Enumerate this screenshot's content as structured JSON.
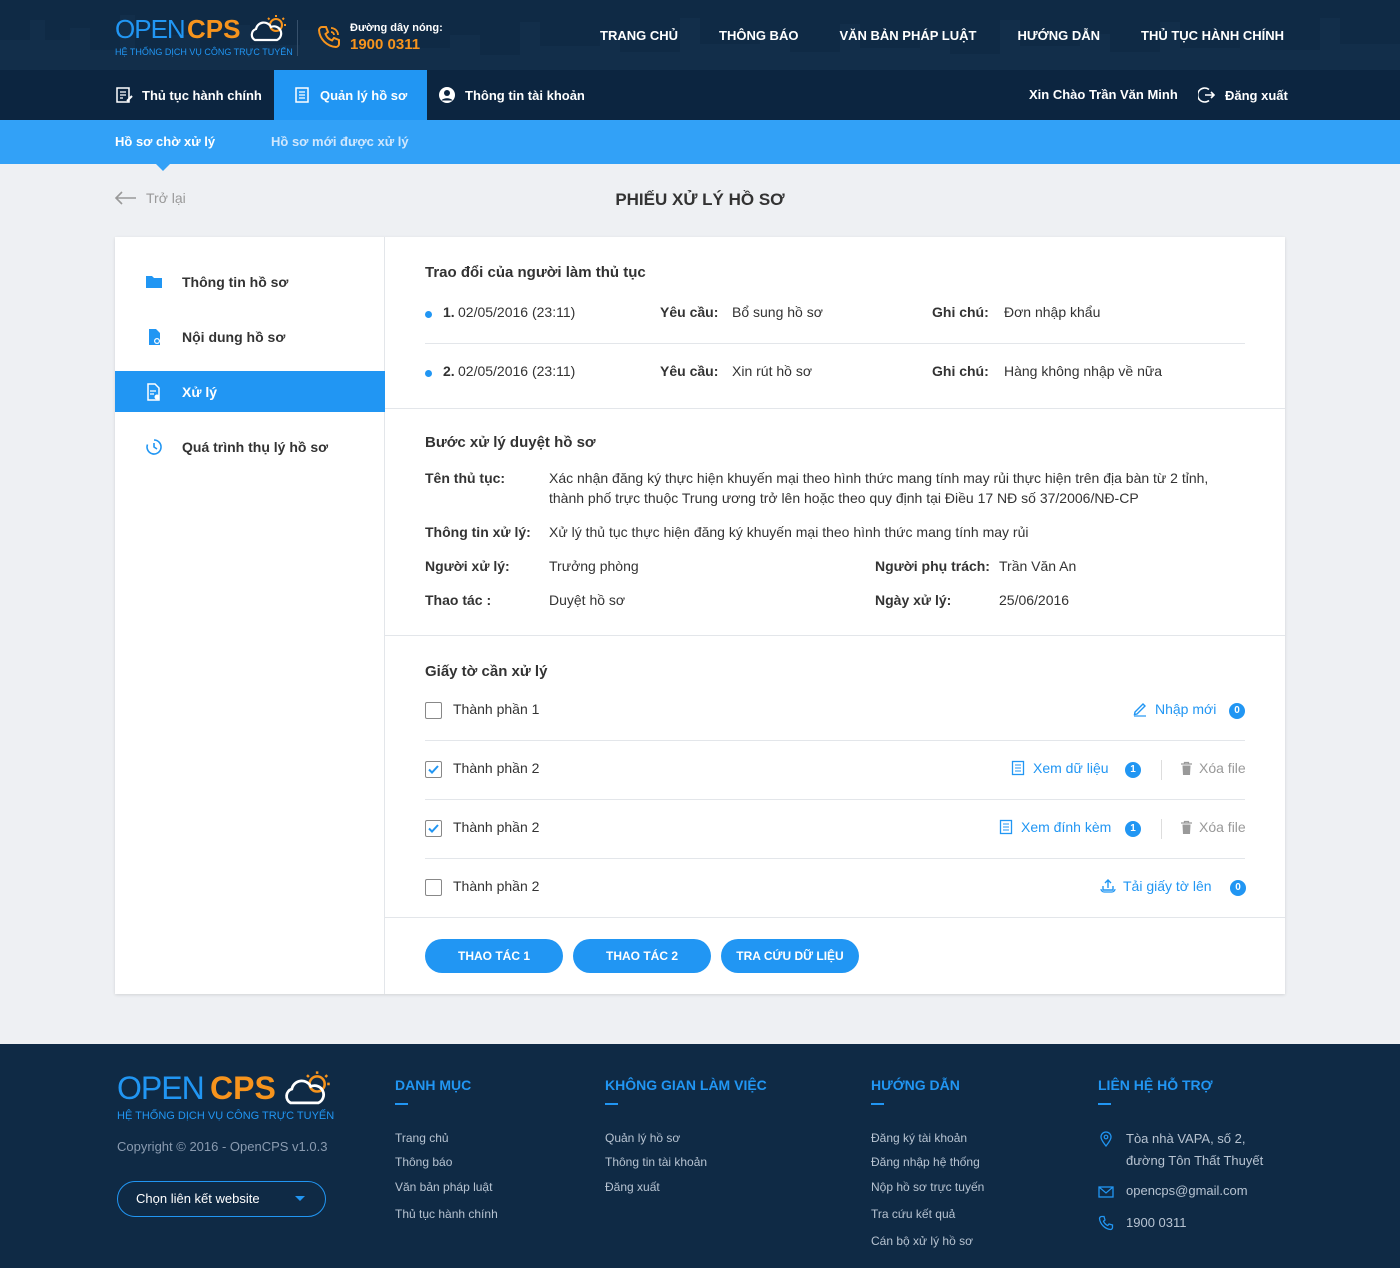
{
  "brand": {
    "open": "OPEN",
    "cps": "CPS",
    "tagline": "HỆ THỐNG DỊCH VỤ CÔNG TRỰC TUYẾN"
  },
  "hotline": {
    "label": "Đường dây nóng:",
    "number": "1900 0311"
  },
  "main_nav": [
    "TRANG CHỦ",
    "THÔNG BÁO",
    "VĂN BẢN PHÁP LUẬT",
    "HƯỚNG DẪN",
    "THỦ TỤC HÀNH CHÍNH"
  ],
  "sub_nav": {
    "items": [
      "Thủ tục hành chính",
      "Quản lý hồ sơ",
      "Thông tin tài khoản"
    ],
    "active_index": 1,
    "greeting": "Xin Chào Trần Văn Minh",
    "logout": "Đăng xuất"
  },
  "tabs": {
    "items": [
      "Hồ sơ chờ xử lý",
      "Hồ sơ mới được xử lý"
    ],
    "active_index": 0
  },
  "back_label": "Trở lại",
  "page_title": "PHIẾU XỬ LÝ HỒ SƠ",
  "sidebar": {
    "items": [
      "Thông tin hồ sơ",
      "Nội dung hồ sơ",
      "Xử lý",
      "Quá trình thụ lý hồ sơ"
    ],
    "active_index": 2
  },
  "exchange": {
    "title": "Trao đổi của người làm thủ tục",
    "request_label": "Yêu cầu:",
    "note_label": "Ghi chú:",
    "entries": [
      {
        "index": "1.",
        "datetime": "02/05/2016 (23:11)",
        "request": "Bổ sung hồ sơ",
        "note": "Đơn nhập khẩu"
      },
      {
        "index": "2.",
        "datetime": "02/05/2016 (23:11)",
        "request": "Xin rút hồ sơ",
        "note": "Hàng không nhập về nữa"
      }
    ]
  },
  "step": {
    "title": "Bước xử lý duyệt hồ sơ",
    "procedure_label": "Tên thủ tục:",
    "procedure_line1": "Xác nhận đăng ký thực hiện khuyến mại theo hình thức mang tính may rủi thực hiện trên địa bàn từ 2 tỉnh,",
    "procedure_line2": "thành phố trực thuộc Trung ương trở lên hoặc theo quy định tại Điều 17 NĐ số 37/2006/NĐ-CP",
    "info_label": "Thông tin xử lý:",
    "info_value": "Xử lý thủ tục thực hiện đăng ký khuyến mại theo hình thức mang tính may rủi",
    "handler_label": "Người xử lý:",
    "handler_value": "Trưởng phòng",
    "owner_label": "Người phụ trách:",
    "owner_value": "Trần Văn An",
    "action_label": "Thao tác :",
    "action_value": "Duyệt hồ sơ",
    "date_label": "Ngày xử lý:",
    "date_value": "25/06/2016"
  },
  "documents": {
    "title": "Giấy tờ cần xử lý",
    "delete_label": "Xóa file",
    "rows": [
      {
        "name": "Thành phần 1",
        "checked": false,
        "action": "Nhập mới",
        "count": "0"
      },
      {
        "name": "Thành phần 2",
        "checked": true,
        "action": "Xem dữ liệu",
        "count": "1"
      },
      {
        "name": "Thành phần 2",
        "checked": true,
        "action": "Xem đính kèm",
        "count": "1"
      },
      {
        "name": "Thành phần 2",
        "checked": false,
        "action": "Tải giấy tờ lên",
        "count": "0"
      }
    ]
  },
  "buttons": [
    "THAO TÁC 1",
    "THAO TÁC 2",
    "TRA CỨU DỮ LIỆU"
  ],
  "footer": {
    "copyright": "Copyright © 2016 - OpenCPS v1.0.3",
    "select_placeholder": "Chọn liên kết website",
    "columns": [
      {
        "heading": "DANH MỤC",
        "links": [
          "Trang chủ",
          "Thông báo",
          "Văn bản pháp luật",
          "Thủ tục hành chính"
        ]
      },
      {
        "heading": "KHÔNG GIAN LÀM VIỆC",
        "links": [
          "Quản lý hồ sơ",
          "Thông tin tài khoản",
          "Đăng xuất"
        ]
      },
      {
        "heading": "HƯỚNG DẪN",
        "links": [
          "Đăng ký tài khoản",
          "Đăng nhập hệ thống",
          "Nộp hồ sơ trực tuyến",
          "Tra cứu kết quả",
          "Cán bộ xử lý hồ sơ"
        ]
      }
    ],
    "contact": {
      "heading": "LIÊN HỆ HỖ TRỢ",
      "address_line1": "Tòa nhà VAPA, số 2,",
      "address_line2": "đường Tôn Thất Thuyết",
      "email": "opencps@gmail.com",
      "phone": "1900 0311"
    }
  },
  "colors": {
    "primary": "#2196f3",
    "accent": "#f7941d",
    "header_bg": "#0f2a45",
    "tab_strip": "#32a1f7"
  }
}
